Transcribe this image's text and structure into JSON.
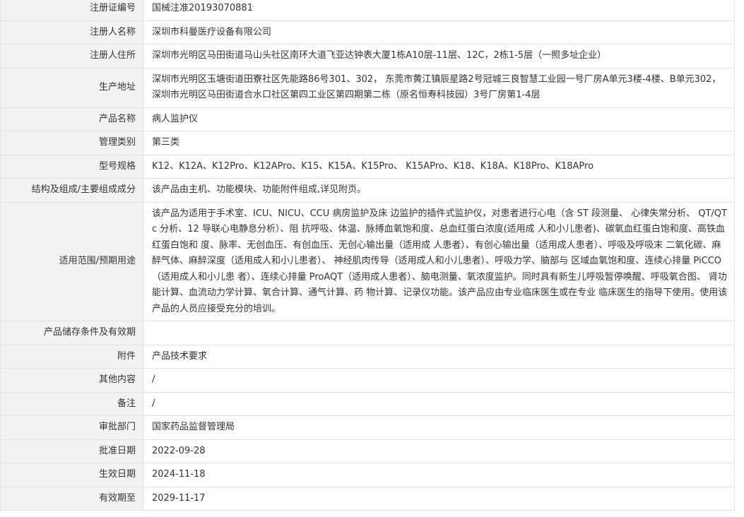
{
  "rows": [
    {
      "label": "注册证编号",
      "value": "国械注准20193070881"
    },
    {
      "label": "注册人名称",
      "value": "深圳市科曼医疗设备有限公司"
    },
    {
      "label": "注册人住所",
      "value": "深圳市光明区马田街道马山头社区南环大道飞亚达钟表大厦1栋A10层-11层、12C，2栋1-5层（一照多址企业）"
    },
    {
      "label": "生产地址",
      "value": "深圳市光明区玉塘街道田寮社区先能路86号301、302， 东莞市黄江镇辰星路2号冠城三良智慧工业园一号厂房A单元3楼-4楼、B单元302， 深圳市光明区马田街道合水口社区第四工业区第四期第二栋（原名恒寿科技园）3号厂房第1-4层"
    },
    {
      "label": "产品名称",
      "value": "病人监护仪"
    },
    {
      "label": "管理类别",
      "value": "第三类"
    },
    {
      "label": "型号规格",
      "value": "K12、K12A、K12Pro、K12APro、K15、K15A、K15Pro、 K15APro、K18、K18A、K18Pro、K18APro"
    },
    {
      "label": "结构及组成/主要组成成分",
      "value": "该产品由主机、功能模块、功能附件组成,详见附页。"
    },
    {
      "label": "适用范围/预期用途",
      "value": "该产品为适用于手术室、ICU、NICU、CCU 病房监护及床 边监护的插件式监护仪，对患者进行心电（含 ST 段测量、 心律失常分析、 QT/QTc 分析、12 导联心电静息分析）、阻 抗呼吸、体温、脉搏血氧饱和度、总血红蛋白浓度(适用成 人和小儿患者)、碳氧血红蛋白饱和度、高铁血红蛋白饱和 度、脉率、无创血压、有创血压、无创心输出量（适用成 人患者）、有创心输出量（适用成人患者）、呼吸及呼吸末 二氧化碳、麻醉气体、麻醉深度（适用成人和小儿患者）、 神经肌肉传导（适用成人和小儿患者）、呼吸力学、脑部与 区域血氧饱和度、连续心排量 PiCCO（适用成人和小儿患 者）、连续心排量 ProAQT（适用成人患者）、脑电测量、氧浓度监护。同时具有新生儿呼吸暂停唤醒、呼吸氧合图、 肾功能计算、血流动力学计算、氧合计算、通气计算、药 物计算、记录仪功能。该产品应由专业临床医生或在专业 临床医生的指导下使用。使用该产品的人员应接受充分的培训。"
    },
    {
      "label": "产品储存条件及有效期",
      "value": ""
    },
    {
      "label": "附件",
      "value": "产品技术要求"
    },
    {
      "label": "其他内容",
      "value": "/"
    },
    {
      "label": "备注",
      "value": "/"
    },
    {
      "label": "审批部门",
      "value": "国家药品监督管理局"
    },
    {
      "label": "批准日期",
      "value": "2022-09-28"
    },
    {
      "label": "生效日期",
      "value": "2024-11-18"
    },
    {
      "label": "有效期至",
      "value": "2029-11-17"
    }
  ]
}
